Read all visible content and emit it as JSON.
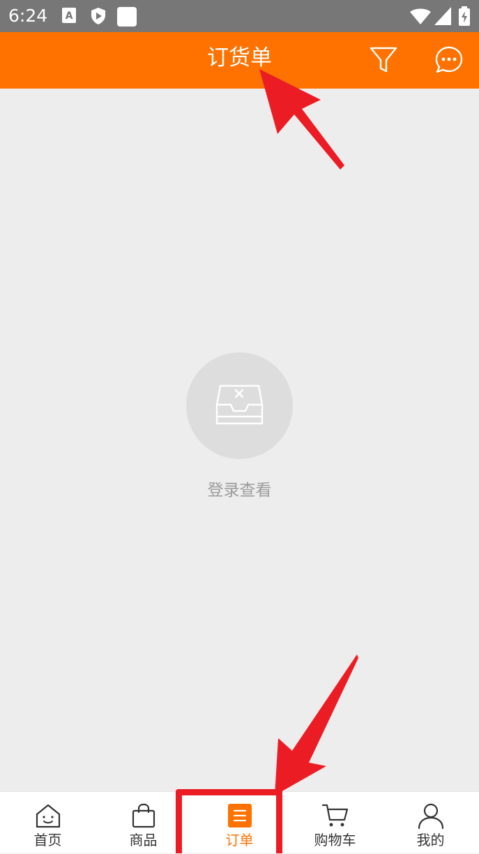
{
  "status_bar": {
    "time": "6:24",
    "icons": [
      "a-notification-icon",
      "play-protect-icon",
      "blank-notification-icon",
      "wifi-icon",
      "signal-icon",
      "battery-charging-icon"
    ]
  },
  "header": {
    "title": "订货单",
    "icons": [
      "filter-icon",
      "message-icon"
    ]
  },
  "empty_state": {
    "icon": "empty-inbox-icon",
    "login_text": "登录查看"
  },
  "tab_bar": {
    "active_index": 2,
    "tabs": [
      {
        "label": "首页",
        "icon": "home-icon"
      },
      {
        "label": "商品",
        "icon": "shopping-bag-icon"
      },
      {
        "label": "订单",
        "icon": "order-list-icon"
      },
      {
        "label": "购物车",
        "icon": "cart-icon"
      },
      {
        "label": "我的",
        "icon": "profile-icon"
      }
    ]
  },
  "colors": {
    "accent": "#ff7200",
    "status_bar": "#777777",
    "background": "#eeeded",
    "annotation": "#ec1c24"
  }
}
